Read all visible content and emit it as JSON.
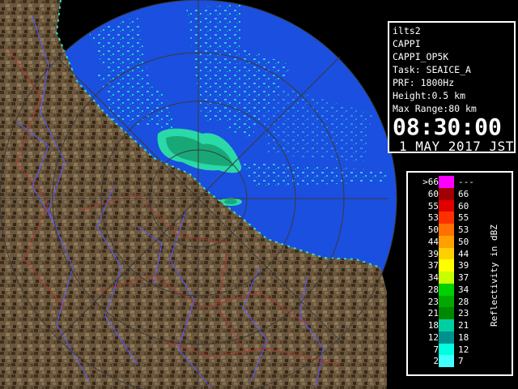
{
  "info": {
    "site": "ilts2",
    "product": "CAPPI",
    "product_code": "CAPPI_OP5K",
    "task": "Task: SEAICE_A",
    "prf": "PRF: 1800Hz",
    "height": "Height:0.5 km",
    "max_range": "Max Range:80 km",
    "time": "08:30:00",
    "date": "1 MAY 2017 JST"
  },
  "legend": {
    "unit": "Reflectivity in dBZ",
    "rows": [
      {
        "low": ">66",
        "high": "---",
        "color": "#ff00ff"
      },
      {
        "low": "60",
        "high": "66",
        "color": "#a00000"
      },
      {
        "low": "55",
        "high": "60",
        "color": "#e00000"
      },
      {
        "low": "53",
        "high": "55",
        "color": "#ff3000"
      },
      {
        "low": "50",
        "high": "53",
        "color": "#ff7000"
      },
      {
        "low": "44",
        "high": "50",
        "color": "#ffa000"
      },
      {
        "low": "39",
        "high": "44",
        "color": "#ffd000"
      },
      {
        "low": "37",
        "high": "39",
        "color": "#ffff00"
      },
      {
        "low": "34",
        "high": "37",
        "color": "#c8ff00"
      },
      {
        "low": "28",
        "high": "34",
        "color": "#00d000"
      },
      {
        "low": "23",
        "high": "28",
        "color": "#00a800"
      },
      {
        "low": "21",
        "high": "23",
        "color": "#008800"
      },
      {
        "low": "18",
        "high": "21",
        "color": "#00d0a0"
      },
      {
        "low": "12",
        "high": "18",
        "color": "#009090"
      },
      {
        "low": "7",
        "high": "12",
        "color": "#00ffe0"
      },
      {
        "low": "2",
        "high": "7",
        "color": "#40ffff"
      }
    ]
  },
  "colors": {
    "sea": "#1a4fe0",
    "land": "#7a6446",
    "rivers": "#5a5aff",
    "boundaries": "#c03030",
    "range_rings": "#404040"
  }
}
